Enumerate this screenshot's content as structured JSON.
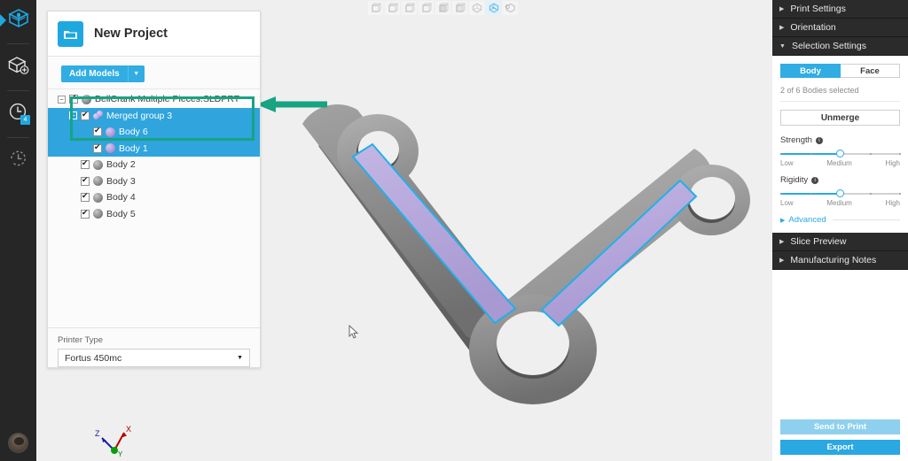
{
  "rail": {
    "items": [
      {
        "name": "models-view",
        "icon": "cube-layers-icon",
        "active": true,
        "badge": ""
      },
      {
        "name": "add-model",
        "icon": "cube-plus-icon",
        "active": false,
        "badge": ""
      },
      {
        "name": "print-queue",
        "icon": "clock-badge-icon",
        "active": false,
        "badge": "4"
      },
      {
        "name": "history",
        "icon": "clock-history-icon",
        "active": false,
        "badge": ""
      }
    ],
    "avatar_label": "User avatar"
  },
  "viewport": {
    "toolbar": [
      {
        "name": "view-front",
        "icon": "cube-front-icon",
        "selected": false
      },
      {
        "name": "view-back",
        "icon": "cube-back-icon",
        "selected": false
      },
      {
        "name": "view-left",
        "icon": "cube-left-icon",
        "selected": false
      },
      {
        "name": "view-right",
        "icon": "cube-right-icon",
        "selected": false
      },
      {
        "name": "view-top",
        "icon": "cube-top-icon",
        "selected": false
      },
      {
        "name": "view-bottom",
        "icon": "cube-bottom-icon",
        "selected": false
      },
      {
        "name": "view-isometric",
        "icon": "cube-iso-icon",
        "selected": false
      },
      {
        "name": "view-fit",
        "icon": "cube-fit-icon",
        "selected": true
      },
      {
        "name": "view-perspective",
        "icon": "cube-perspective-icon",
        "selected": false
      }
    ],
    "axis": {
      "x": "X",
      "y": "Y",
      "z": "Z"
    },
    "callout": "arrow pointing to merged group selection"
  },
  "panel": {
    "title": "New Project",
    "project_icon": "folder-icon",
    "add_models_label": "Add Models",
    "tree": [
      {
        "label": "BellCrank Multiple Pieces.SLDPRT",
        "depth": 0,
        "twisty": "minus",
        "icon": "part-icon",
        "checked": true,
        "selected": false
      },
      {
        "label": "Merged group 3",
        "depth": 1,
        "twisty": "minus",
        "icon": "merged-bodies-icon",
        "checked": true,
        "selected": true
      },
      {
        "label": "Body 6",
        "depth": 2,
        "twisty": "none",
        "icon": "body-purple-icon",
        "checked": true,
        "selected": true
      },
      {
        "label": "Body 1",
        "depth": 2,
        "twisty": "none",
        "icon": "body-purple-icon",
        "checked": true,
        "selected": true
      },
      {
        "label": "Body 2",
        "depth": 1,
        "twisty": "none",
        "icon": "body-grey-icon",
        "checked": true,
        "selected": false
      },
      {
        "label": "Body 3",
        "depth": 1,
        "twisty": "none",
        "icon": "body-grey-icon",
        "checked": true,
        "selected": false
      },
      {
        "label": "Body 4",
        "depth": 1,
        "twisty": "none",
        "icon": "body-grey-icon",
        "checked": true,
        "selected": false
      },
      {
        "label": "Body 5",
        "depth": 1,
        "twisty": "none",
        "icon": "body-grey-icon",
        "checked": true,
        "selected": false
      }
    ],
    "printer_type_label": "Printer Type",
    "printer_type_value": "Fortus 450mc"
  },
  "right": {
    "sections": [
      {
        "label": "Print Settings",
        "expanded": false
      },
      {
        "label": "Orientation",
        "expanded": false
      },
      {
        "label": "Selection Settings",
        "expanded": true
      },
      {
        "label": "Slice Preview",
        "expanded": false
      },
      {
        "label": "Manufacturing Notes",
        "expanded": false
      }
    ],
    "selection": {
      "toggle": {
        "body": "Body",
        "face": "Face",
        "active": "Body"
      },
      "count_text": "2 of 6 Bodies selected",
      "unmerge_label": "Unmerge",
      "strength": {
        "label": "Strength",
        "low": "Low",
        "medium": "Medium",
        "high": "High",
        "value": 50
      },
      "rigidity": {
        "label": "Rigidity",
        "low": "Low",
        "medium": "Medium",
        "high": "High",
        "value": 50
      },
      "advanced_label": "Advanced"
    },
    "footer": {
      "send_to_print": "Send to Print",
      "export": "Export"
    }
  },
  "colors": {
    "accent": "#2aa8e2",
    "selection_row": "#2fa4dd",
    "callout": "#18a383",
    "panel_dark": "#2b2b2b",
    "body_grey": "#8a8a8a",
    "body_selected": "#b3a6d9",
    "edge_highlight": "#22b0e8"
  }
}
